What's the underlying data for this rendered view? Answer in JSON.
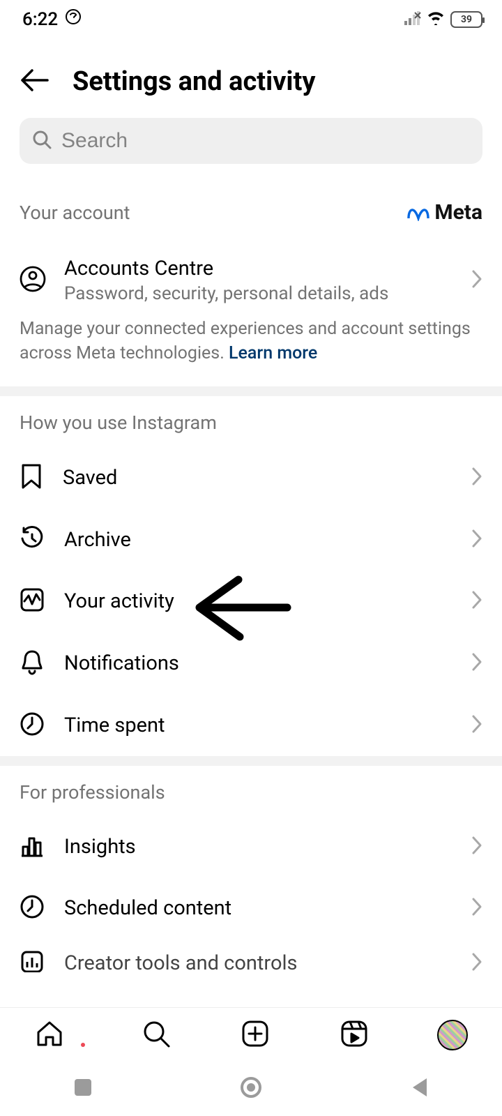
{
  "status": {
    "time": "6:22",
    "battery": "39"
  },
  "header": {
    "title": "Settings and activity"
  },
  "search": {
    "placeholder": "Search"
  },
  "your_account": {
    "section": "Your account",
    "brand": "Meta",
    "accounts_centre": {
      "title": "Accounts Centre",
      "sub": "Password, security, personal details, ads"
    },
    "desc": "Manage your connected experiences and account settings across Meta technologies. ",
    "learn_more": "Learn more"
  },
  "usage": {
    "section": "How you use Instagram",
    "items": {
      "saved": "Saved",
      "archive": "Archive",
      "activity": "Your activity",
      "notifications": "Notifications",
      "time": "Time spent"
    }
  },
  "pro": {
    "section": "For professionals",
    "items": {
      "insights": "Insights",
      "scheduled": "Scheduled content",
      "creator": "Creator tools and controls"
    }
  }
}
